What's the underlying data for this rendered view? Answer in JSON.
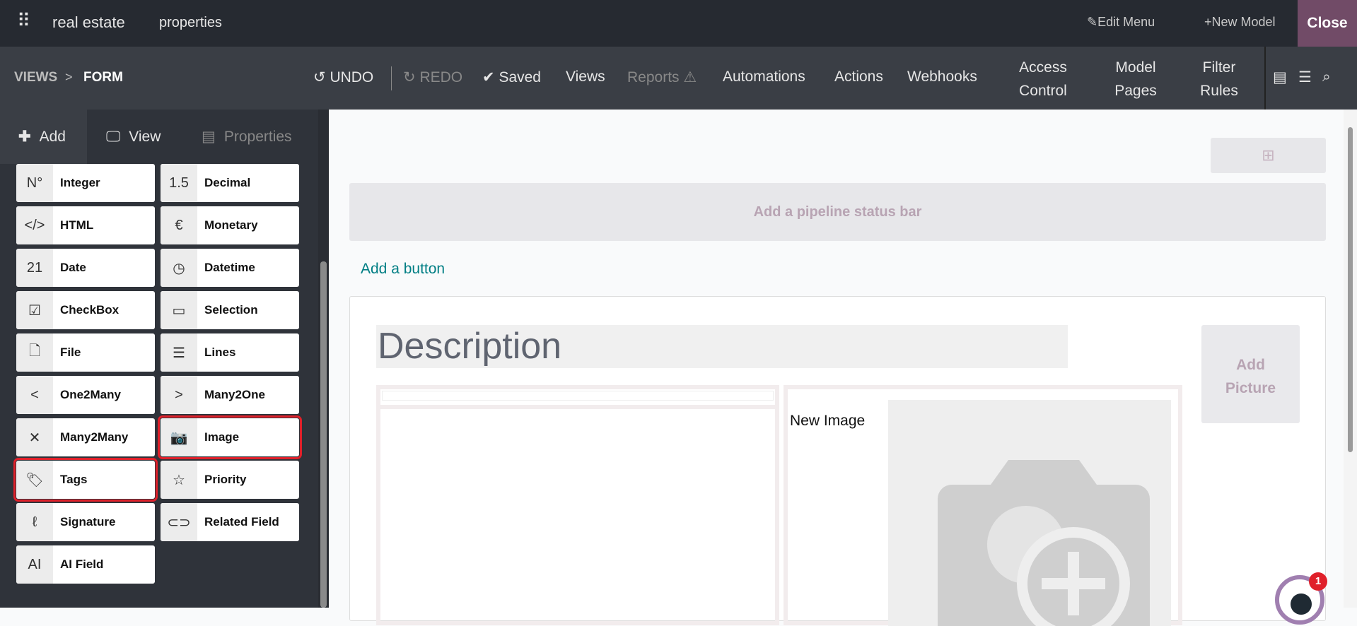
{
  "topbar": {
    "app": "real estate",
    "model": "properties",
    "edit_menu": "Edit Menu",
    "new_model": "New Model",
    "close": "Close"
  },
  "toolbar": {
    "breadcrumb_views": "VIEWS",
    "breadcrumb_sep": ">",
    "breadcrumb_form": "FORM",
    "undo": "UNDO",
    "redo": "REDO",
    "saved": "Saved",
    "views": "Views",
    "reports": "Reports",
    "automations": "Automations",
    "actions": "Actions",
    "webhooks": "Webhooks",
    "access_1": "Access",
    "access_2": "Control",
    "model_1": "Model",
    "model_2": "Pages",
    "filter_1": "Filter",
    "filter_2": "Rules"
  },
  "sidebar": {
    "tabs": [
      "Add",
      "View",
      "Properties"
    ],
    "fields": [
      {
        "label": "Integer",
        "icon": "N°"
      },
      {
        "label": "Decimal",
        "icon": "1.5"
      },
      {
        "label": "HTML",
        "icon": "</>"
      },
      {
        "label": "Monetary",
        "icon": "€"
      },
      {
        "label": "Date",
        "icon": "21"
      },
      {
        "label": "Datetime",
        "icon": "◷"
      },
      {
        "label": "CheckBox",
        "icon": "☑"
      },
      {
        "label": "Selection",
        "icon": "▭"
      },
      {
        "label": "File",
        "icon": "🗋"
      },
      {
        "label": "Lines",
        "icon": "☰"
      },
      {
        "label": "One2Many",
        "icon": "<"
      },
      {
        "label": "Many2One",
        "icon": ">"
      },
      {
        "label": "Many2Many",
        "icon": "✕"
      },
      {
        "label": "Image",
        "icon": "📷"
      },
      {
        "label": "Tags",
        "icon": "🏷"
      },
      {
        "label": "Priority",
        "icon": "☆"
      },
      {
        "label": "Signature",
        "icon": "ℓ"
      },
      {
        "label": "Related Field",
        "icon": "⊂⊃"
      },
      {
        "label": "AI Field",
        "icon": "AI"
      }
    ]
  },
  "form": {
    "pipeline": "Add a pipeline status bar",
    "add_button": "Add a button",
    "title_placeholder": "Description",
    "add_picture_1": "Add",
    "add_picture_2": "Picture",
    "new_image": "New Image"
  },
  "chat": {
    "badge": "1"
  },
  "colors": {
    "accent": "#714b67",
    "teal": "#017e84",
    "highlight": "#e0202a"
  }
}
